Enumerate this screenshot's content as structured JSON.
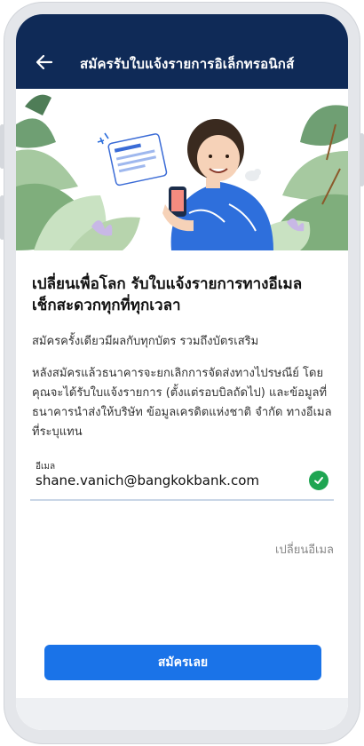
{
  "appbar": {
    "title": "สมัครรับใบแจ้งรายการอิเล็กทรอนิกส์",
    "back_icon": "arrow-left-icon"
  },
  "main": {
    "headline_line1": "เปลี่ยนเพื่อโลก รับใบแจ้งรายการทางอีเมล",
    "headline_line2": "เช็กสะดวกทุกที่ทุกเวลา",
    "subtitle": "สมัครครั้งเดียวมีผลกับทุกบัตร รวมถึงบัตรเสริม",
    "description": "หลังสมัครแล้วธนาคารจะยกเลิกการจัดส่งทางไปรษณีย์ โดยคุณจะได้รับใบแจ้งรายการ (ตั้งแต่รอบบิลถัดไป) และข้อมูลที่ธนาคารนำส่งให้บริษัท ข้อมูลเครดิตแห่งชาติ จำกัด ทางอีเมลที่ระบุแทน"
  },
  "email_field": {
    "label": "อีเมล",
    "value": "shane.vanich@bangkokbank.com",
    "status_icon": "check-circle-icon"
  },
  "change_email_label": "เปลี่ยนอีเมล",
  "submit_label": "สมัครเลย",
  "colors": {
    "appbar": "#0f2a57",
    "primary_button": "#1a73e8",
    "success": "#1fa552"
  }
}
